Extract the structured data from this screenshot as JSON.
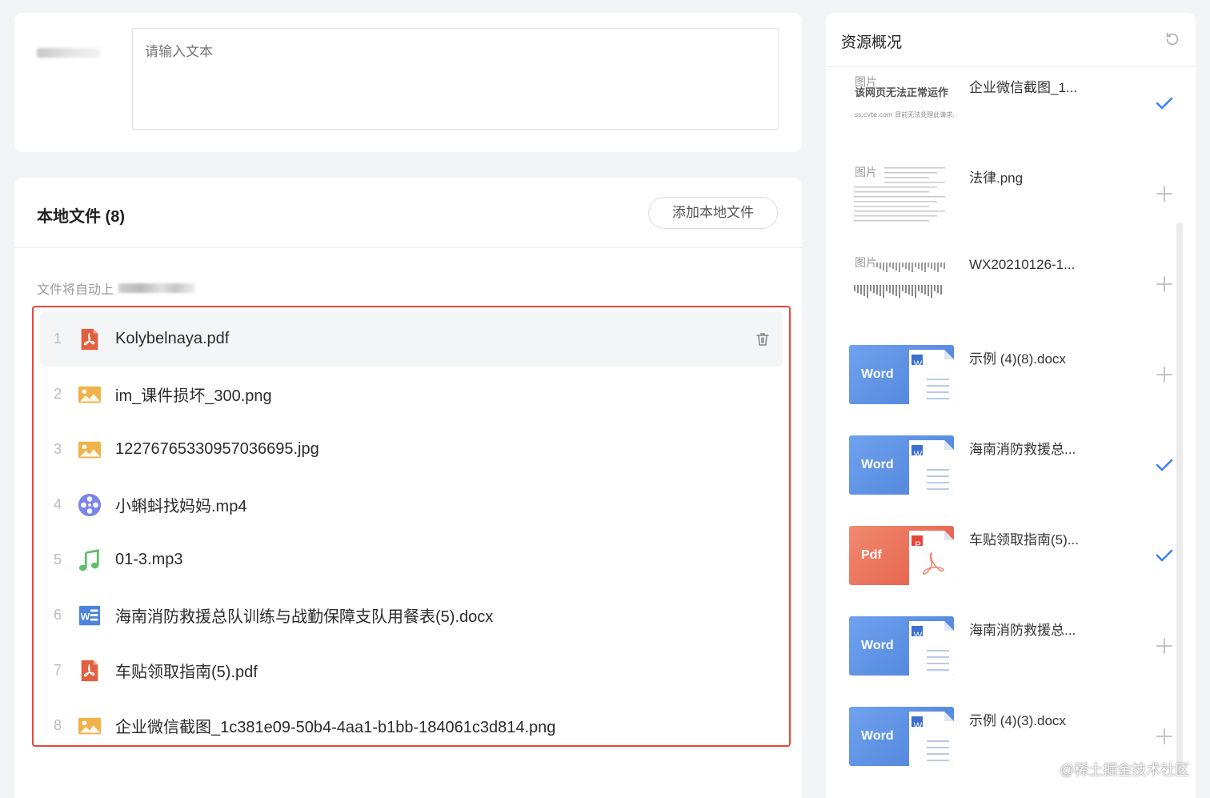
{
  "input": {
    "placeholder": "请输入文本"
  },
  "local_files": {
    "title": "本地文件 (8)",
    "add_button": "添加本地文件",
    "auto_hint": "文件将自动上",
    "files": [
      {
        "index": "1",
        "name": "Kolybelnaya.pdf",
        "type": "pdf"
      },
      {
        "index": "2",
        "name": "im_课件损坏_300.png",
        "type": "image"
      },
      {
        "index": "3",
        "name": "1227676533095703​6695.jpg",
        "type": "image"
      },
      {
        "index": "4",
        "name": "小蝌蚪找妈妈.mp4",
        "type": "video"
      },
      {
        "index": "5",
        "name": "01-3.mp3",
        "type": "audio"
      },
      {
        "index": "6",
        "name": "海南消防救援总队训练与战勤保障支队用餐表(5).docx",
        "type": "word"
      },
      {
        "index": "7",
        "name": "车贴领取指南(5).pdf",
        "type": "pdf"
      },
      {
        "index": "8",
        "name": "企业微信截图_1c381e09-50b4-4aa1-b1bb-184061c3d814.png",
        "type": "image"
      }
    ]
  },
  "resources": {
    "title": "资源概况",
    "items": [
      {
        "name": "企业微信截图_1...",
        "thumb": "image",
        "tag": "图片",
        "status": "checked"
      },
      {
        "name": "法律.png",
        "thumb": "image",
        "tag": "图片",
        "status": "add"
      },
      {
        "name": "WX20210126-1...",
        "thumb": "image",
        "tag": "图片",
        "status": "add"
      },
      {
        "name": "示例 (4)(8).docx",
        "thumb": "word",
        "label": "Word",
        "badge": "W",
        "status": "add"
      },
      {
        "name": "海南消防救援总...",
        "thumb": "word",
        "label": "Word",
        "badge": "W",
        "status": "checked"
      },
      {
        "name": "车贴领取指南(5)...",
        "thumb": "pdf",
        "label": "Pdf",
        "badge": "P",
        "status": "checked"
      },
      {
        "name": "海南消防救援总...",
        "thumb": "word",
        "label": "Word",
        "badge": "W",
        "status": "add"
      },
      {
        "name": "示例 (4)(3).docx",
        "thumb": "word",
        "label": "Word",
        "badge": "W",
        "status": "add"
      }
    ]
  },
  "image_thumb_texts": [
    "该网页无法正常运作",
    "ss.cvte.com 目前无法处理此请求。"
  ],
  "watermark": "@稀土掘金技术社区",
  "colors": {
    "accent_blue": "#3b82f6",
    "highlight_red": "#e4473a",
    "pdf_red": "#e0603f",
    "image_orange": "#f0b24a",
    "video_purple": "#7b86e8",
    "audio_green": "#5fbf6a",
    "word_blue": "#4d83dc"
  },
  "icons": {
    "file_pdf": "pdf-icon",
    "file_image": "image-icon",
    "file_video": "video-icon",
    "file_audio": "music-icon",
    "file_word": "word-icon",
    "delete": "trash-icon",
    "refresh": "refresh-icon",
    "checked": "check-icon",
    "add": "plus-icon"
  }
}
